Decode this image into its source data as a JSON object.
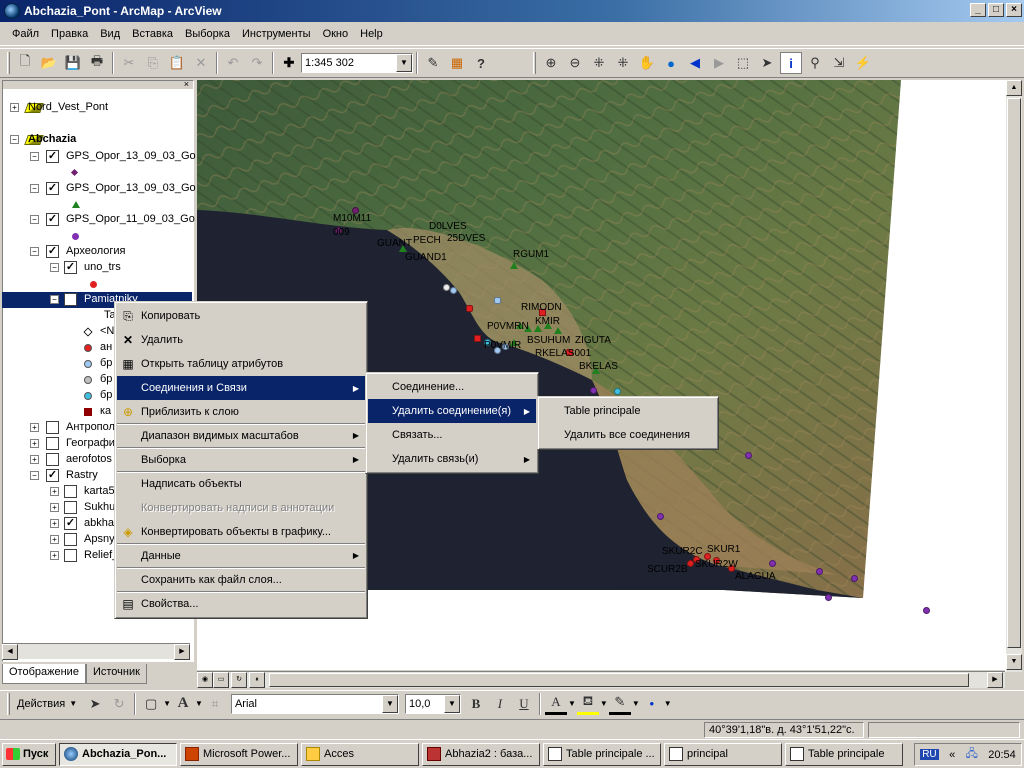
{
  "window": {
    "title": "Abchazia_Pont - ArcMap - ArcView"
  },
  "menubar": [
    {
      "label": "Файл"
    },
    {
      "label": "Правка"
    },
    {
      "label": "Вид"
    },
    {
      "label": "Вставка"
    },
    {
      "label": "Выборка"
    },
    {
      "label": "Инструменты"
    },
    {
      "label": "Окно"
    },
    {
      "label": "Help"
    }
  ],
  "toolbar": {
    "scale": "1:345 302"
  },
  "toc": {
    "rows": [
      {
        "label": "Nord_Vest_Pont"
      },
      {
        "label": "Abchazia"
      },
      {
        "label": "GPS_Opor_13_09_03_Go"
      },
      {
        "label": "GPS_Opor_13_09_03_Go"
      },
      {
        "label": "GPS_Opor_11_09_03_Go"
      },
      {
        "label": "Археология"
      },
      {
        "label": "uno_trs"
      },
      {
        "label": "Pamiatniky"
      },
      {
        "label": "Ta"
      },
      {
        "label": "<N"
      },
      {
        "label": "ан"
      },
      {
        "label": "бр"
      },
      {
        "label": "бр"
      },
      {
        "label": "бр"
      },
      {
        "label": "ка"
      },
      {
        "label": "Антропол"
      },
      {
        "label": "Географи"
      },
      {
        "label": "aerofotos"
      },
      {
        "label": "Rastry"
      },
      {
        "label": "karta5"
      },
      {
        "label": "Sukhu"
      },
      {
        "label": "abkha"
      },
      {
        "label": "Apsny"
      },
      {
        "label": "Relief_"
      }
    ],
    "tabs": [
      {
        "label": "Отображение"
      },
      {
        "label": "Источник"
      }
    ]
  },
  "context_menu": {
    "items": [
      {
        "label": "Копировать"
      },
      {
        "label": "Удалить"
      },
      {
        "label": "Открыть таблицу атрибутов"
      },
      {
        "label": "Соединения и Связи"
      },
      {
        "label": "Приблизить к слою"
      },
      {
        "label": "Диапазон видимых масштабов"
      },
      {
        "label": "Выборка"
      },
      {
        "label": "Надписать объекты"
      },
      {
        "label": "Конвертировать надписи в аннотации"
      },
      {
        "label": "Конвертировать объекты в графику..."
      },
      {
        "label": "Данные"
      },
      {
        "label": "Сохранить как файл слоя..."
      },
      {
        "label": "Свойства..."
      }
    ]
  },
  "submenu_joins": {
    "items": [
      {
        "label": "Соединение..."
      },
      {
        "label": "Удалить соединение(я)"
      },
      {
        "label": "Связать..."
      },
      {
        "label": "Удалить связь(и)"
      }
    ]
  },
  "submenu_remove": {
    "items": [
      {
        "label": "Table principale"
      },
      {
        "label": "Удалить все соединения"
      }
    ]
  },
  "map_labels": [
    {
      "text": "M10M11"
    },
    {
      "text": "009"
    },
    {
      "text": "D0LVES"
    },
    {
      "text": "PECH"
    },
    {
      "text": "25DVES"
    },
    {
      "text": "GUANT"
    },
    {
      "text": "GUAND1"
    },
    {
      "text": "RGUM1"
    },
    {
      "text": "RIMODN"
    },
    {
      "text": "P0VMRN"
    },
    {
      "text": "KMIR"
    },
    {
      "text": "P0VMIR"
    },
    {
      "text": "BSUHUM"
    },
    {
      "text": "ZIGUTA"
    },
    {
      "text": "RKELAS001"
    },
    {
      "text": "BKELAS"
    },
    {
      "text": "SKUR2C"
    },
    {
      "text": "SKUR1"
    },
    {
      "text": "SCUR2B"
    },
    {
      "text": "SKUR2W"
    },
    {
      "text": "ALAGUA"
    }
  ],
  "drawbar": {
    "actions": "Действия",
    "font": "Arial",
    "size": "10,0"
  },
  "status": {
    "coords": "40°39'1,18\"в. д.  43°1'51,22\"с."
  },
  "taskbar": {
    "start": "Пуск",
    "tasks": [
      {
        "label": "Abchazia_Pon..."
      },
      {
        "label": "Microsoft Power..."
      },
      {
        "label": "Acces"
      },
      {
        "label": "Abhazia2 : база..."
      },
      {
        "label": "Table principale ..."
      },
      {
        "label": "principal"
      },
      {
        "label": "Table principale"
      }
    ],
    "lang": "RU",
    "clock": "20:54"
  }
}
